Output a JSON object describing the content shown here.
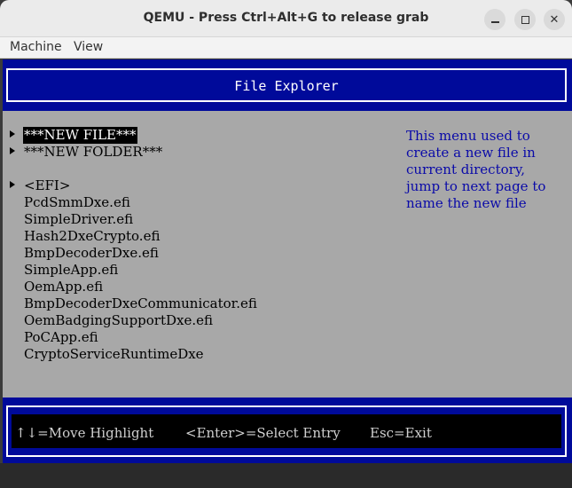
{
  "window": {
    "title": "QEMU - Press Ctrl+Alt+G to release grab",
    "minimize_icon": "minimize-icon",
    "maximize_icon": "maximize-icon",
    "close_icon": "close-icon",
    "close_glyph": "✕"
  },
  "menubar": {
    "items": [
      "Machine",
      "View"
    ]
  },
  "guest": {
    "header_title": "File Explorer",
    "entries": [
      {
        "label": "***NEW FILE***",
        "arrow": true,
        "selected": true
      },
      {
        "label": "***NEW FOLDER***",
        "arrow": true,
        "selected": false
      },
      {
        "label": "<EFI>",
        "arrow": true,
        "selected": false
      },
      {
        "label": "PcdSmmDxe.efi",
        "arrow": false,
        "selected": false
      },
      {
        "label": "SimpleDriver.efi",
        "arrow": false,
        "selected": false
      },
      {
        "label": "Hash2DxeCrypto.efi",
        "arrow": false,
        "selected": false
      },
      {
        "label": "BmpDecoderDxe.efi",
        "arrow": false,
        "selected": false
      },
      {
        "label": "SimpleApp.efi",
        "arrow": false,
        "selected": false
      },
      {
        "label": "OemApp.efi",
        "arrow": false,
        "selected": false
      },
      {
        "label": "BmpDecoderDxeCommunicator.efi",
        "arrow": false,
        "selected": false
      },
      {
        "label": "OemBadgingSupportDxe.efi",
        "arrow": false,
        "selected": false
      },
      {
        "label": "PoCApp.efi",
        "arrow": false,
        "selected": false
      },
      {
        "label": "CryptoServiceRuntimeDxe",
        "arrow": false,
        "selected": false
      }
    ],
    "help_text": "This menu used to\ncreate a new file in\ncurrent directory,\njump to next page to\nname the new file",
    "hints": [
      "↑↓=Move Highlight",
      "<Enter>=Select Entry",
      "Esc=Exit"
    ],
    "colors": {
      "screen_blue": "#000a9a",
      "body_gray": "#a8a8a8",
      "help_blue": "#0a0aa8"
    }
  }
}
